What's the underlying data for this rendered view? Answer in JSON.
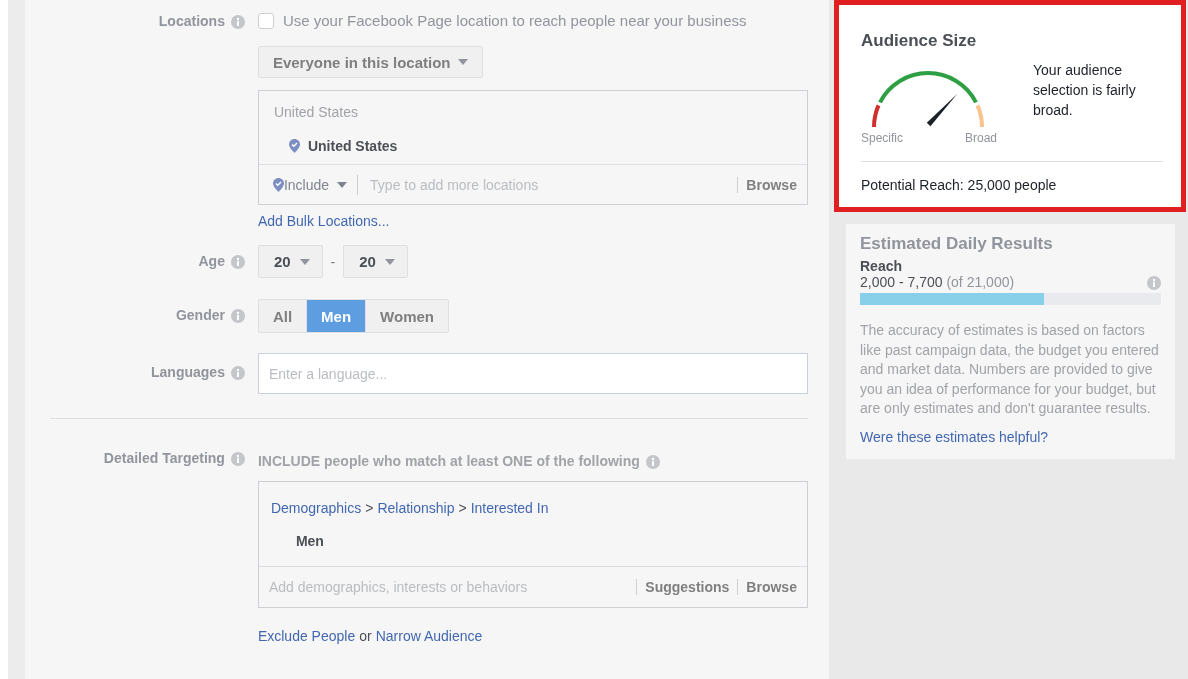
{
  "locations": {
    "label": "Locations",
    "checkbox": {
      "label": "Use your Facebook Page location to reach people near your business",
      "checked": false
    },
    "dropdown": "Everyone in this location",
    "search_header": "United States",
    "selected_locations": [
      "United States"
    ],
    "include_dropdown": "Include",
    "placeholder": "Type to add more locations",
    "browse": "Browse",
    "bulk_link": "Add Bulk Locations..."
  },
  "age": {
    "label": "Age",
    "from": "20",
    "separator": "-",
    "to": "20"
  },
  "gender": {
    "label": "Gender",
    "options": [
      {
        "label": "All",
        "selected": false
      },
      {
        "label": "Men",
        "selected": true
      },
      {
        "label": "Women",
        "selected": false
      }
    ]
  },
  "languages": {
    "label": "Languages",
    "placeholder": "Enter a language..."
  },
  "detailed_targeting": {
    "label": "Detailed Targeting",
    "instruction": "INCLUDE people who match at least ONE of the following",
    "breadcrumb": [
      "Demographics",
      ">",
      "Relationship",
      ">",
      "Interested In"
    ],
    "items": [
      "Men"
    ],
    "placeholder": "Add demographics, interests or behaviors",
    "actions": [
      "Suggestions",
      "Browse"
    ],
    "footer": [
      {
        "kind": "link",
        "text": "Exclude People"
      },
      {
        "kind": "text",
        "text": "or"
      },
      {
        "kind": "link",
        "text": "Narrow Audience"
      }
    ]
  },
  "audience_size": {
    "title": "Audience Size",
    "highlighted": true,
    "level": 0.74,
    "low_label": "Specific",
    "high_label": "Broad",
    "description": "Your audience selection is fairly broad.",
    "potential_reach": "Potential Reach: 25,000 people"
  },
  "estimated_daily_results": {
    "title": "Estimated Daily Results",
    "metric": "Reach",
    "range": "2,000 - 7,700",
    "total": "(of 21,000)",
    "level": 0.61,
    "note": "The accuracy of estimates is based on factors like past campaign data, the budget you entered and market data. Numbers are provided to give you an idea of performance for your budget, but are only estimates and don't guarantee results.",
    "link": "Were these estimates helpful?"
  }
}
